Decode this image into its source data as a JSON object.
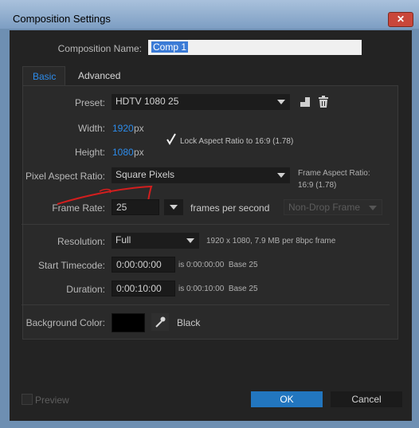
{
  "window": {
    "title": "Composition Settings",
    "close_glyph": "✕"
  },
  "composition_name": {
    "label": "Composition Name:",
    "value": "Comp 1"
  },
  "tabs": [
    {
      "label": "Basic"
    },
    {
      "label": "Advanced"
    }
  ],
  "preset": {
    "label": "Preset:",
    "value": "HDTV 1080 25"
  },
  "width": {
    "label": "Width:",
    "value": "1920",
    "unit": "px"
  },
  "height": {
    "label": "Height:",
    "value": "1080",
    "unit": "px"
  },
  "lock_aspect": {
    "label": "Lock Aspect Ratio to 16:9 (1.78)",
    "checked": true
  },
  "pixel_aspect": {
    "label": "Pixel Aspect Ratio:",
    "value": "Square Pixels"
  },
  "frame_aspect": {
    "label": "Frame Aspect Ratio:",
    "value": "16:9 (1.78)"
  },
  "frame_rate": {
    "label": "Frame Rate:",
    "value": "25",
    "unit": "frames per second",
    "drop_frame": "Non-Drop Frame"
  },
  "resolution": {
    "label": "Resolution:",
    "value": "Full",
    "info": "1920 x 1080, 7.9 MB per 8bpc frame"
  },
  "start_timecode": {
    "label": "Start Timecode:",
    "value": "0:00:00:00",
    "info": "is 0:00:00:00  Base 25"
  },
  "duration": {
    "label": "Duration:",
    "value": "0:00:10:00",
    "info": "is 0:00:10:00  Base 25"
  },
  "background": {
    "label": "Background Color:",
    "color_name": "Black",
    "swatch": "#000000"
  },
  "footer": {
    "preview_label": "Preview",
    "ok_label": "OK",
    "cancel_label": "Cancel"
  },
  "colors": {
    "accent": "#2d8ceb",
    "ok_button": "#2276bf",
    "annotation": "#d21e1e"
  },
  "icons": {
    "checkmark": "checkmark-icon",
    "eyedropper": "eyedropper-icon",
    "trash": "trash-icon",
    "save_preset": "save-preset-icon"
  }
}
